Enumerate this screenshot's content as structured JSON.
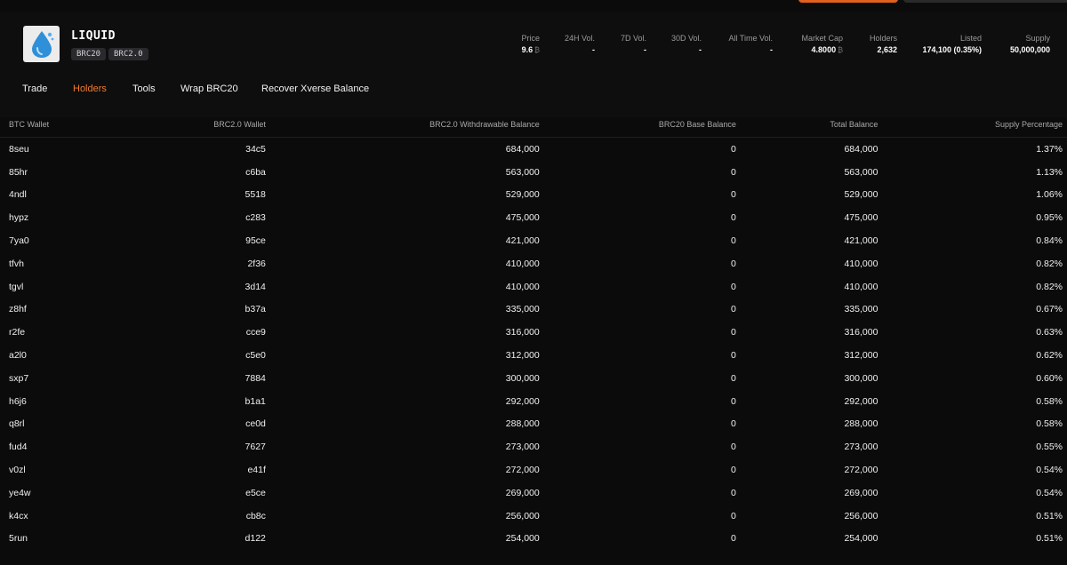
{
  "token": {
    "name": "LIQUID",
    "badges": [
      "BRC20",
      "BRC2.0"
    ],
    "logo_icon": "water-drop-icon"
  },
  "stats": [
    {
      "label": "Price",
      "value": "9.6",
      "unit_icon": "bitcoin-icon"
    },
    {
      "label": "24H Vol.",
      "value": "-"
    },
    {
      "label": "7D Vol.",
      "value": "-"
    },
    {
      "label": "30D Vol.",
      "value": "-"
    },
    {
      "label": "All Time Vol.",
      "value": "-"
    },
    {
      "label": "Market Cap",
      "value": "4.8000",
      "unit_icon": "bitcoin-icon"
    },
    {
      "label": "Holders",
      "value": "2,632"
    },
    {
      "label": "Listed",
      "value": "174,100 (0.35%)"
    },
    {
      "label": "Supply",
      "value": "50,000,000"
    }
  ],
  "tabs": [
    "Trade",
    "Holders",
    "Tools",
    "Wrap BRC20",
    "Recover Xverse Balance"
  ],
  "active_tab": "Holders",
  "colors": {
    "accent": "#f07a2e",
    "background": "#0b0b0b"
  },
  "table": {
    "headers": [
      "BTC Wallet",
      "BRC2.0 Wallet",
      "BRC2.0 Withdrawable Balance",
      "BRC20 Base Balance",
      "Total Balance",
      "Supply Percentage"
    ],
    "rows": [
      [
        "8seu",
        "34c5",
        "684,000",
        "0",
        "684,000",
        "1.37%"
      ],
      [
        "85hr",
        "c6ba",
        "563,000",
        "0",
        "563,000",
        "1.13%"
      ],
      [
        "4ndl",
        "5518",
        "529,000",
        "0",
        "529,000",
        "1.06%"
      ],
      [
        "hypz",
        "c283",
        "475,000",
        "0",
        "475,000",
        "0.95%"
      ],
      [
        "7ya0",
        "95ce",
        "421,000",
        "0",
        "421,000",
        "0.84%"
      ],
      [
        "tfvh",
        "2f36",
        "410,000",
        "0",
        "410,000",
        "0.82%"
      ],
      [
        "tgvl",
        "3d14",
        "410,000",
        "0",
        "410,000",
        "0.82%"
      ],
      [
        "z8hf",
        "b37a",
        "335,000",
        "0",
        "335,000",
        "0.67%"
      ],
      [
        "r2fe",
        "cce9",
        "316,000",
        "0",
        "316,000",
        "0.63%"
      ],
      [
        "a2l0",
        "c5e0",
        "312,000",
        "0",
        "312,000",
        "0.62%"
      ],
      [
        "sxp7",
        "7884",
        "300,000",
        "0",
        "300,000",
        "0.60%"
      ],
      [
        "h6j6",
        "b1a1",
        "292,000",
        "0",
        "292,000",
        "0.58%"
      ],
      [
        "q8rl",
        "ce0d",
        "288,000",
        "0",
        "288,000",
        "0.58%"
      ],
      [
        "fud4",
        "7627",
        "273,000",
        "0",
        "273,000",
        "0.55%"
      ],
      [
        "v0zl",
        "e41f",
        "272,000",
        "0",
        "272,000",
        "0.54%"
      ],
      [
        "ye4w",
        "e5ce",
        "269,000",
        "0",
        "269,000",
        "0.54%"
      ],
      [
        "k4cx",
        "cb8c",
        "256,000",
        "0",
        "256,000",
        "0.51%"
      ],
      [
        "5run",
        "d122",
        "254,000",
        "0",
        "254,000",
        "0.51%"
      ]
    ]
  }
}
